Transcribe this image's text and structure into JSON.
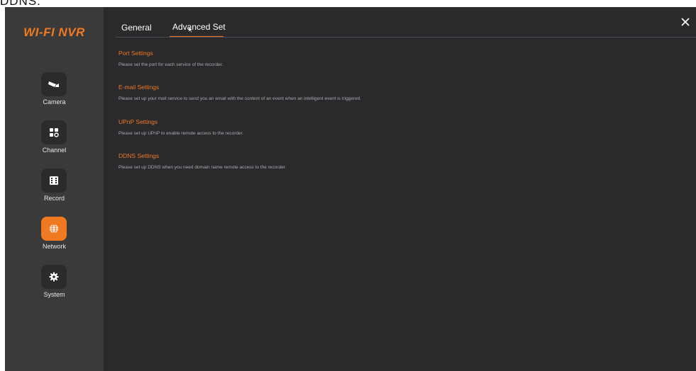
{
  "caption": "DDNS.",
  "sidebar": {
    "logo": "WI-FI NVR",
    "items": [
      {
        "label": "Camera",
        "icon": "camera-icon"
      },
      {
        "label": "Channel",
        "icon": "channel-icon"
      },
      {
        "label": "Record",
        "icon": "record-icon"
      },
      {
        "label": "Network",
        "icon": "network-icon",
        "active": true
      },
      {
        "label": "System",
        "icon": "gear-icon"
      }
    ]
  },
  "tabs": {
    "general": "General",
    "advanced": "Advanced Set",
    "active": "advanced"
  },
  "sections": [
    {
      "title": "Port Settings",
      "desc": "Please set the port for each service of the recorder."
    },
    {
      "title": "E-mail Settings",
      "desc": "Please set up your mail service to send you an email with the content of an event when an intelligent event is triggered."
    },
    {
      "title": "UPnP Settings",
      "desc": "Please set up UPnP to enable remote access to the recorder."
    },
    {
      "title": "DDNS Settings",
      "desc": "Please set up DDNS when you need domain name remote access to the recorder."
    }
  ],
  "colors": {
    "accent": "#f07a22",
    "sidebar_bg": "#3a3a3a",
    "main_bg": "#2a2a2d"
  }
}
